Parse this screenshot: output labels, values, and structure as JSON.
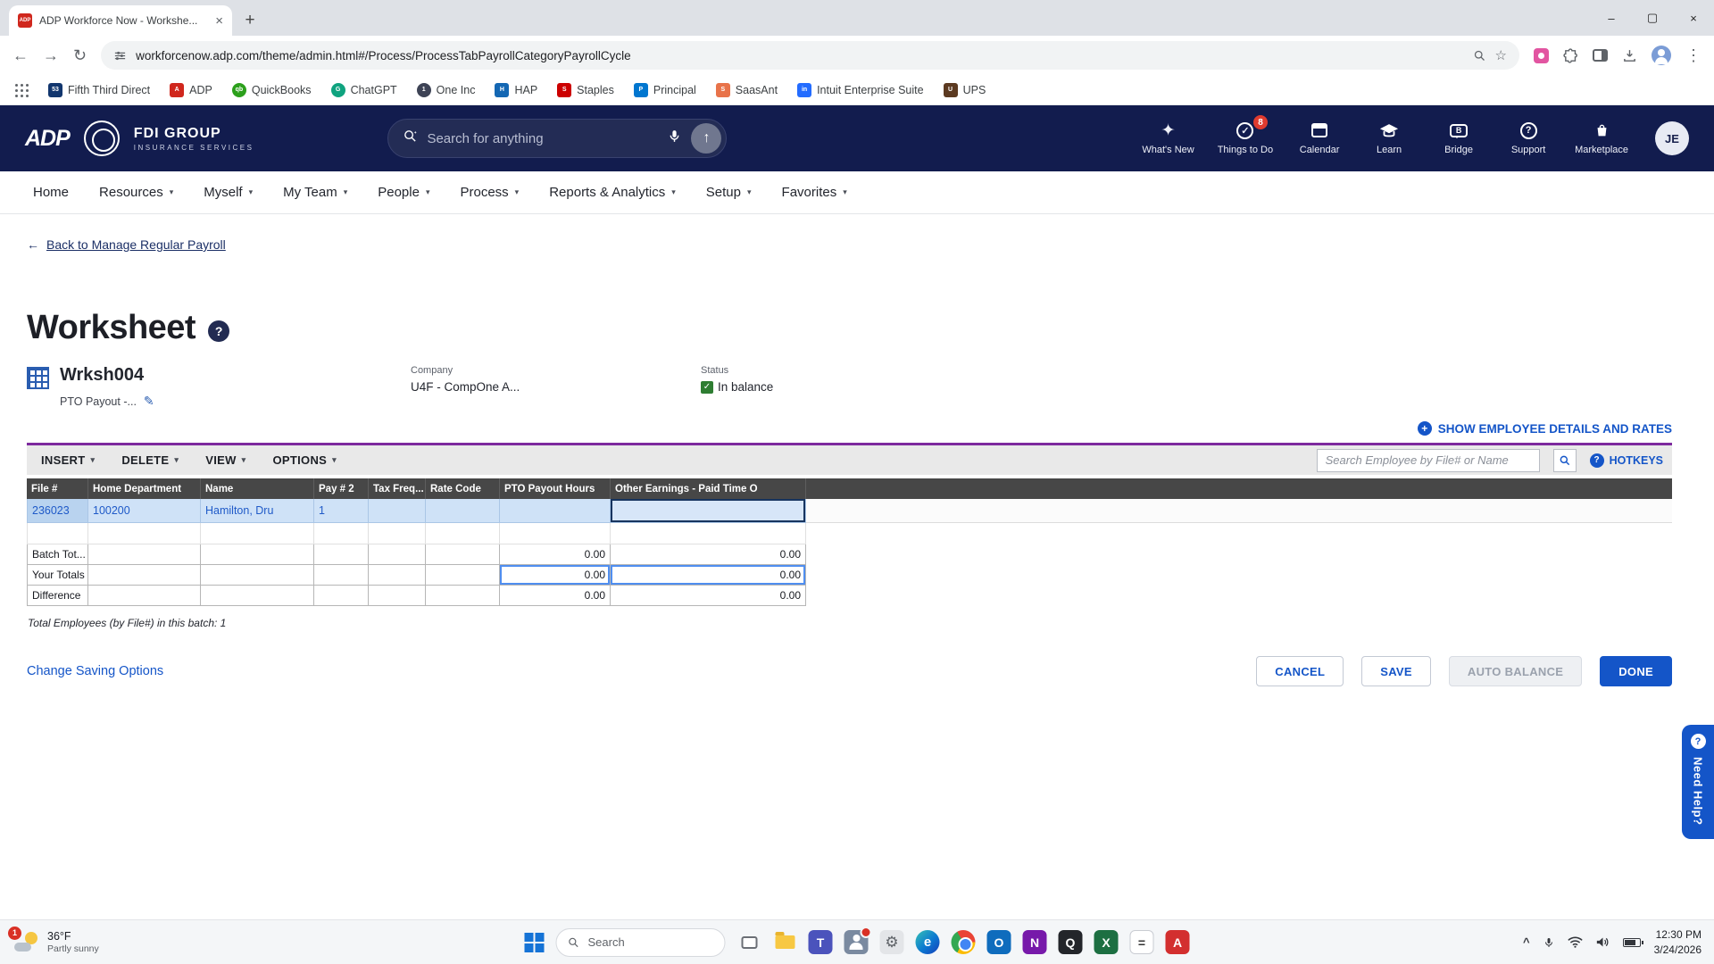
{
  "colors": {
    "accent_blue": "#1455c8",
    "header_navy": "#121c4e",
    "toolbar_purple": "#7d2a9e",
    "status_green": "#2e7d32",
    "row_highlight": "#cfe2f7",
    "adp_red": "#d0271d"
  },
  "browser": {
    "tab_title": "ADP Workforce Now - Workshe...",
    "tab_favicon": "ADP",
    "url": "workforcenow.adp.com/theme/admin.html#/Process/ProcessTabPayrollCategoryPayrollCycle",
    "bookmarks": [
      {
        "label": "Fifth Third Direct",
        "glyph": "53"
      },
      {
        "label": "ADP",
        "glyph": "A"
      },
      {
        "label": "QuickBooks",
        "glyph": "qb"
      },
      {
        "label": "ChatGPT",
        "glyph": "G"
      },
      {
        "label": "One Inc",
        "glyph": "1"
      },
      {
        "label": "HAP",
        "glyph": "H"
      },
      {
        "label": "Staples",
        "glyph": "S"
      },
      {
        "label": "Principal",
        "glyph": "P"
      },
      {
        "label": "SaasAnt",
        "glyph": "S"
      },
      {
        "label": "Intuit Enterprise Suite",
        "glyph": "in"
      },
      {
        "label": "UPS",
        "glyph": "U"
      }
    ]
  },
  "app_header": {
    "logo": "ADP",
    "brand_name": "FDI GROUP",
    "brand_tagline": "INSURANCE SERVICES",
    "search_placeholder": "Search for anything",
    "icons": [
      {
        "label": "What's New"
      },
      {
        "label": "Things to Do",
        "badge": "8"
      },
      {
        "label": "Calendar"
      },
      {
        "label": "Learn"
      },
      {
        "label": "Bridge"
      },
      {
        "label": "Support"
      },
      {
        "label": "Marketplace"
      }
    ],
    "avatar_initials": "JE"
  },
  "main_nav": {
    "items": [
      {
        "label": "Home"
      },
      {
        "label": "Resources"
      },
      {
        "label": "Myself"
      },
      {
        "label": "My Team"
      },
      {
        "label": "People"
      },
      {
        "label": "Process"
      },
      {
        "label": "Reports & Analytics"
      },
      {
        "label": "Setup"
      },
      {
        "label": "Favorites"
      }
    ]
  },
  "page": {
    "back_link": "Back to Manage Regular Payroll",
    "title": "Worksheet",
    "worksheet_id": "Wrksh004",
    "worksheet_subtitle": "PTO Payout -...",
    "company_label": "Company",
    "company_value": "U4F - CompOne A...",
    "status_label": "Status",
    "status_value": "In balance",
    "show_details_link": "SHOW EMPLOYEE DETAILS AND RATES",
    "toolbar": {
      "insert": "INSERT",
      "delete": "DELETE",
      "view": "VIEW",
      "options": "OPTIONS",
      "search_placeholder": "Search Employee by File# or Name",
      "hotkeys": "HOTKEYS"
    },
    "table": {
      "columns": [
        "File #",
        "Home Department",
        "Name",
        "Pay # 2",
        "Tax Freq...",
        "Rate Code",
        "PTO Payout Hours",
        "Other Earnings - Paid Time O"
      ],
      "rows": [
        {
          "file": "236023",
          "dept": "100200",
          "name": "Hamilton, Dru",
          "pay2": "1",
          "tax": "",
          "rate": "",
          "pto": "",
          "other": ""
        }
      ],
      "totals": [
        {
          "label": "Batch Tot...",
          "pto": "0.00",
          "other": "0.00"
        },
        {
          "label": "Your Totals",
          "pto": "0.00",
          "other": "0.00"
        },
        {
          "label": "Difference",
          "pto": "0.00",
          "other": "0.00"
        }
      ],
      "footnote": "Total Employees (by File#) in this batch: 1"
    },
    "change_saving_options": "Change Saving Options",
    "buttons": {
      "cancel": "CANCEL",
      "save": "SAVE",
      "auto_balance": "AUTO BALANCE",
      "done": "DONE"
    },
    "need_help": "Need Help?"
  },
  "taskbar": {
    "weather_badge": "1",
    "weather_temp": "36°F",
    "weather_desc": "Partly sunny",
    "search_placeholder": "Search",
    "apps": [
      {
        "name": "task-view",
        "glyph": ""
      },
      {
        "name": "file-explorer",
        "glyph": ""
      },
      {
        "name": "teams",
        "glyph": "T"
      },
      {
        "name": "contacts",
        "glyph": ""
      },
      {
        "name": "settings",
        "glyph": "⚙"
      },
      {
        "name": "edge",
        "glyph": "e"
      },
      {
        "name": "chrome",
        "glyph": ""
      },
      {
        "name": "outlook",
        "glyph": "O"
      },
      {
        "name": "onenote",
        "glyph": "N"
      },
      {
        "name": "quickbooks",
        "glyph": "Q"
      },
      {
        "name": "excel",
        "glyph": "X"
      },
      {
        "name": "calculator",
        "glyph": "="
      },
      {
        "name": "acrobat",
        "glyph": "A"
      }
    ],
    "time": "12:30 PM",
    "date": "3/24/2026"
  }
}
